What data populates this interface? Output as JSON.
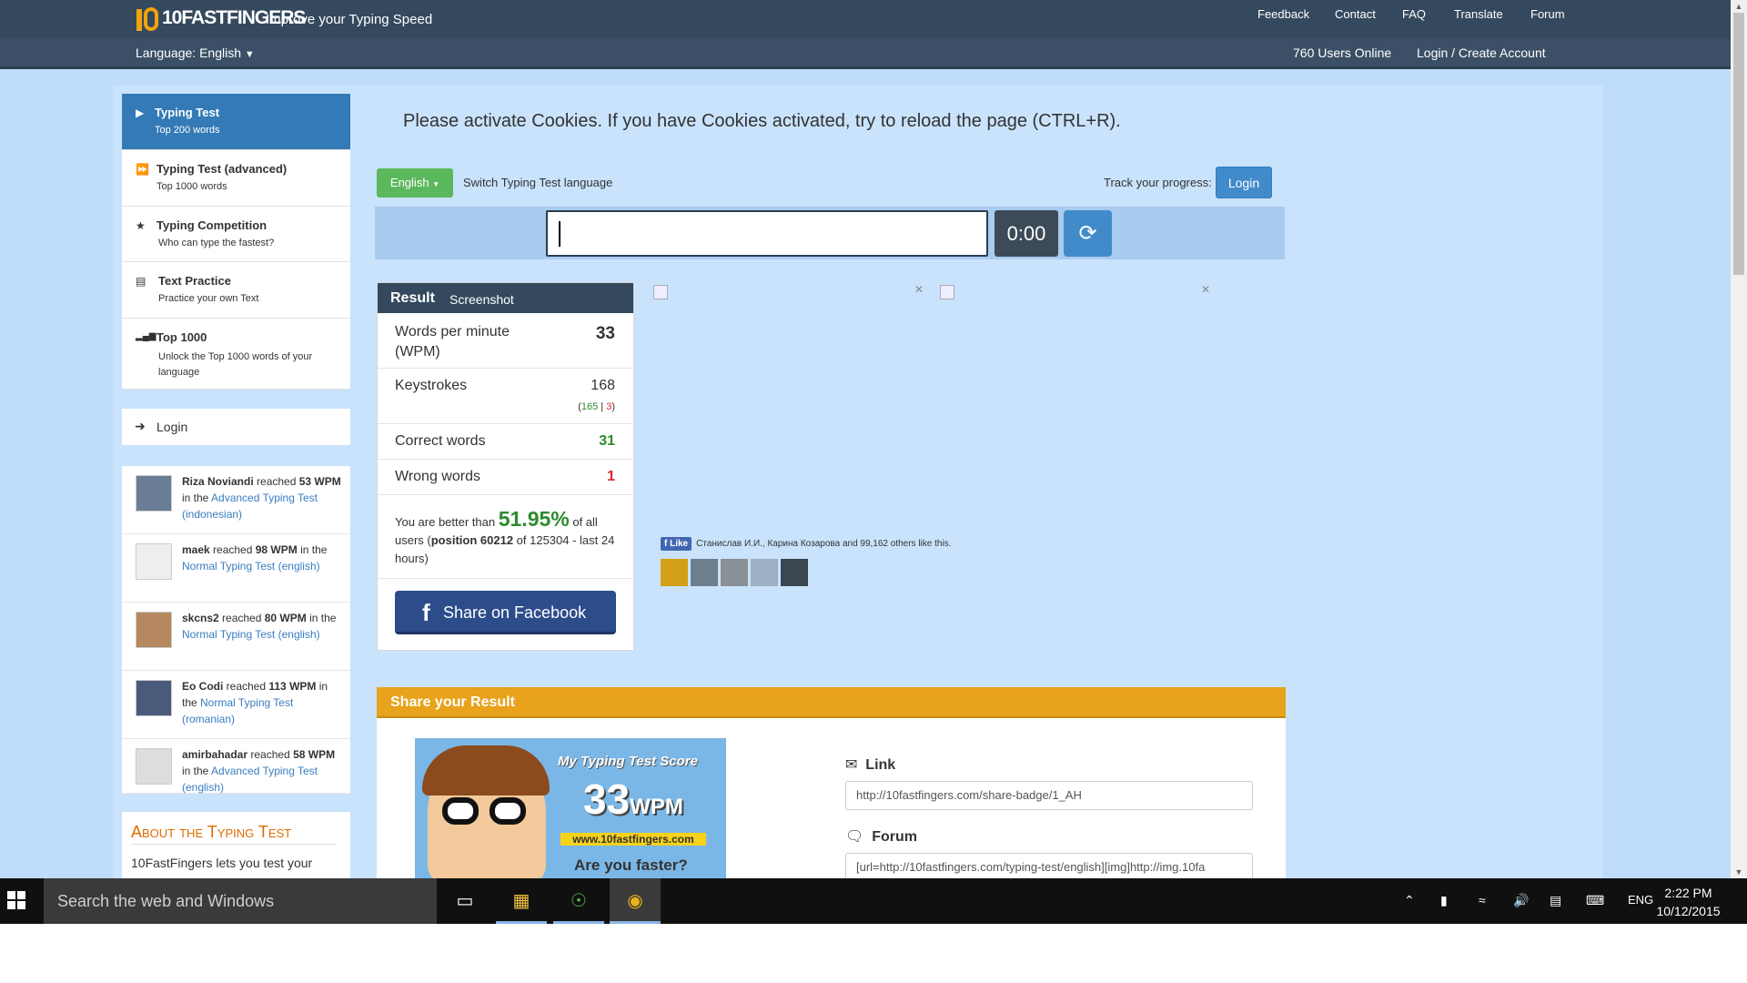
{
  "header": {
    "logo": "10FASTFINGERS",
    "tagline": "Improve your Typing Speed",
    "links": [
      "Feedback",
      "Contact",
      "FAQ",
      "Translate",
      "Forum"
    ],
    "language": "Language: English",
    "online": "760 Users Online",
    "login": "Login / Create Account"
  },
  "sidebar": {
    "menu": [
      {
        "title": "Typing Test",
        "sub": "Top 200 words",
        "icon": "play-icon"
      },
      {
        "title": "Typing Test (advanced)",
        "sub": "Top 1000 words",
        "icon": "fast-forward-icon"
      },
      {
        "title": "Typing Competition",
        "sub": "Who can type the fastest?",
        "icon": "trophy-icon"
      },
      {
        "title": "Text Practice",
        "sub": "Practice your own Text",
        "icon": "document-icon"
      },
      {
        "title": "Top 1000",
        "sub": "Unlock the Top 1000 words of your language",
        "icon": "signal-icon"
      }
    ],
    "login": "Login",
    "feed": [
      {
        "user": "Riza Noviandi",
        "a": " reached ",
        "wpm": "53 WPM",
        "b": " in the ",
        "test": "Advanced Typing Test (indonesian)"
      },
      {
        "user": "maek",
        "a": " reached ",
        "wpm": "98 WPM",
        "b": " in the ",
        "test": "Normal Typing Test (english)"
      },
      {
        "user": "skcns2",
        "a": " reached ",
        "wpm": "80 WPM",
        "b": " in the ",
        "test": "Normal Typing Test (english)"
      },
      {
        "user": "Eo Codi",
        "a": " reached ",
        "wpm": "113 WPM",
        "b": " in the ",
        "test": "Normal Typing Test (romanian)"
      },
      {
        "user": "amirbahadar",
        "a": " reached ",
        "wpm": "58 WPM",
        "b": " in the ",
        "test": "Advanced Typing Test (english)"
      }
    ],
    "about_title": "About the Typing Test",
    "about_text": "10FastFingers lets you test your"
  },
  "main": {
    "cookie": "Please activate Cookies. If you have Cookies activated, try to reload the page (CTRL+R).",
    "lang_btn": "English",
    "switch": "Switch Typing Test language",
    "track": "Track your progress:",
    "login_btn": "Login",
    "timer": "0:00"
  },
  "result": {
    "title": "Result",
    "screenshot": "Screenshot",
    "wpm_label": "Words per minute",
    "wpm_label2": "(WPM)",
    "wpm": "33",
    "keystrokes_label": "Keystrokes",
    "keystrokes": "168",
    "ks_open": "(",
    "ks_correct": "165",
    "ks_sep": " | ",
    "ks_wrong": "3",
    "ks_close": ")",
    "correct_label": "Correct words",
    "correct": "31",
    "wrong_label": "Wrong words",
    "wrong": "1",
    "better_a": "You are better than ",
    "better_pct": "51.95%",
    "better_b": " of all users (",
    "position": "position 60212",
    "better_c": " of 125304 - last 24 hours)",
    "share_fb": "Share on Facebook"
  },
  "social": {
    "like": "Like",
    "text": "Станислав И.И., Карина Козарова and 99,162 others like this."
  },
  "share": {
    "title": "Share your Result",
    "badge_l1": "My Typing Test Score",
    "badge_wpm": "33",
    "badge_unit": "WPM",
    "badge_site": "www.10fastfingers.com",
    "badge_q": "Are you faster?",
    "link_label": "Link",
    "link": "http://10fastfingers.com/share-badge/1_AH",
    "forum_label": "Forum",
    "forum": "[url=http://10fastfingers.com/typing-test/english][img]http://img.10fa"
  },
  "taskbar": {
    "search": "Search the web and Windows",
    "lang": "ENG",
    "time": "2:22 PM",
    "date": "10/12/2015"
  },
  "colors": {
    "nav": "#34495e",
    "page_bg": "#bfdcfa",
    "active": "#337ab7",
    "share": "#e8a21b",
    "green": "#5cb85c"
  }
}
